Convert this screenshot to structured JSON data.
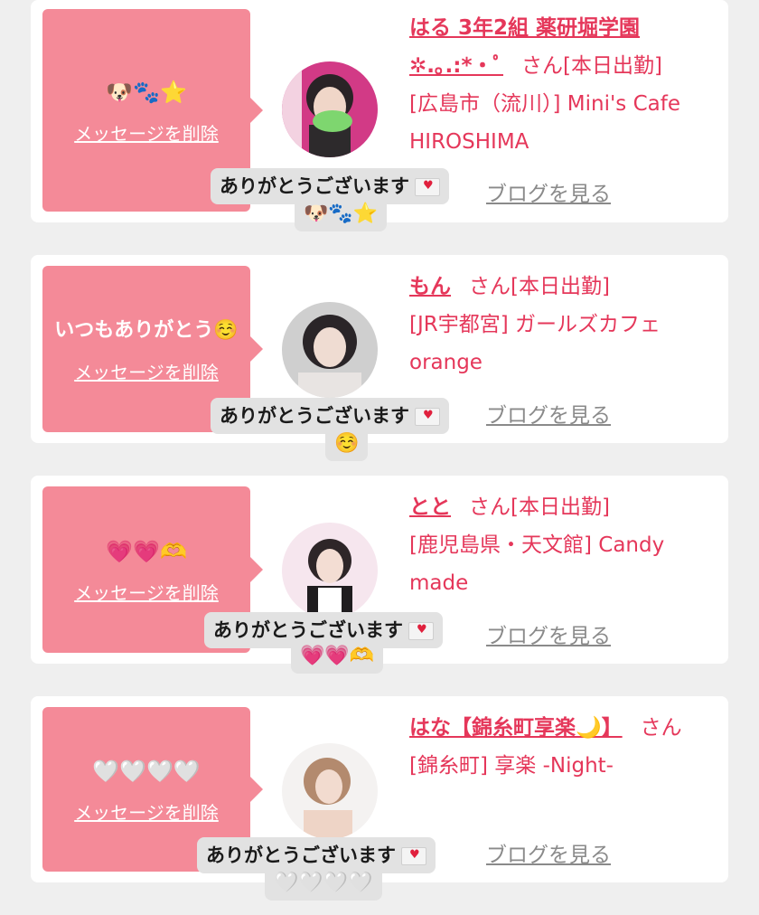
{
  "cards": [
    {
      "message": "🐶🐾⭐",
      "delete_label": "メッセージを削除",
      "name": "はる 3年2組 薬研堀学園 ✲.｡.:*・ﾟ",
      "san": "さん[本日出勤]",
      "store": "[広島市（流川）] Mini's Cafe HIROSHIMA",
      "blog_label": "ブログを見る",
      "thanks": "ありがとうございます",
      "thanks_emoji": "🐶🐾⭐"
    },
    {
      "message": "いつもありがとう☺️",
      "delete_label": "メッセージを削除",
      "name": "もん",
      "san": "さん[本日出勤]",
      "store": "[JR宇都宮] ガールズカフェorange",
      "blog_label": "ブログを見る",
      "thanks": "ありがとうございます",
      "thanks_emoji": "☺️"
    },
    {
      "message": "💗💗🫶",
      "delete_label": "メッセージを削除",
      "name": "とと",
      "san": "さん[本日出勤]",
      "store": "[鹿児島県・天文館] Candy made",
      "blog_label": "ブログを見る",
      "thanks": "ありがとうございます",
      "thanks_emoji": "💗💗🫶"
    },
    {
      "message": "🤍🤍🤍🤍",
      "delete_label": "メッセージを削除",
      "name": "はな【錦糸町享楽🌙】",
      "san": "さん",
      "store": "[錦糸町] 享楽 -Night-",
      "blog_label": "ブログを見る",
      "thanks": "ありがとうございます",
      "thanks_emoji": "🤍🤍🤍🤍"
    }
  ],
  "colors": {
    "accent": "#e5375a",
    "bubble": "#f48a98",
    "background": "#efefef"
  },
  "icons": [
    "avatar-photo",
    "envelope-heart-icon"
  ]
}
